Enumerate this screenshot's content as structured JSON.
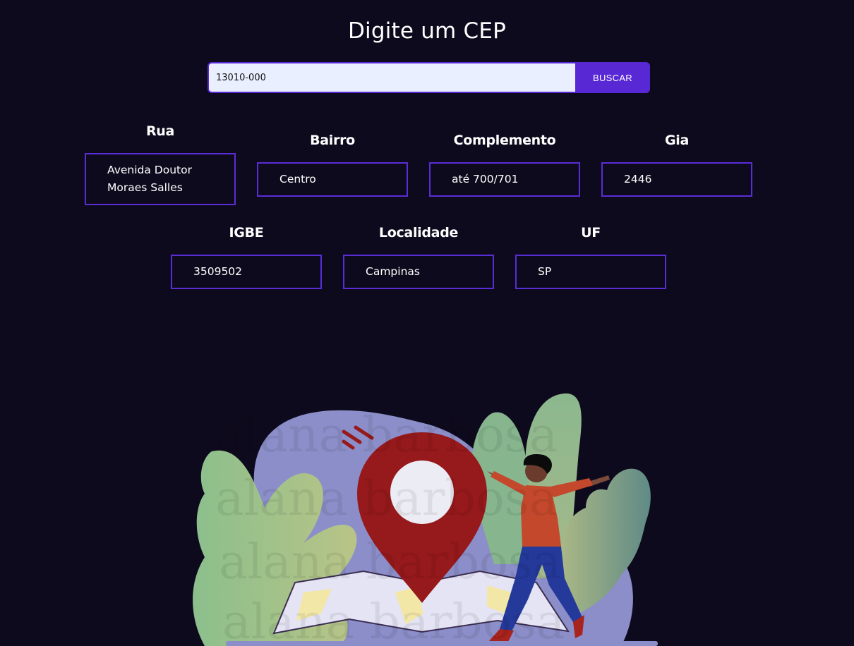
{
  "header": {
    "title": "Digite um CEP"
  },
  "search": {
    "value": "13010-000",
    "button_label": "BUSCAR"
  },
  "fields": {
    "rua": {
      "label": "Rua",
      "value": "Avenida Doutor Moraes Salles"
    },
    "bairro": {
      "label": "Bairro",
      "value": "Centro"
    },
    "complemento": {
      "label": "Complemento",
      "value": "até 700/701"
    },
    "gia": {
      "label": "Gia",
      "value": "2446"
    },
    "igbe": {
      "label": "IGBE",
      "value": "3509502"
    },
    "localidade": {
      "label": "Localidade",
      "value": "Campinas"
    },
    "uf": {
      "label": "UF",
      "value": "SP"
    }
  },
  "illustration": {
    "watermark": "alana barbosa",
    "colors": {
      "background": "#0e0a1d",
      "accent": "#5828d4",
      "pin": "#96191b",
      "blob": "#8b8ec8",
      "leaf": "#8fb88e"
    }
  }
}
